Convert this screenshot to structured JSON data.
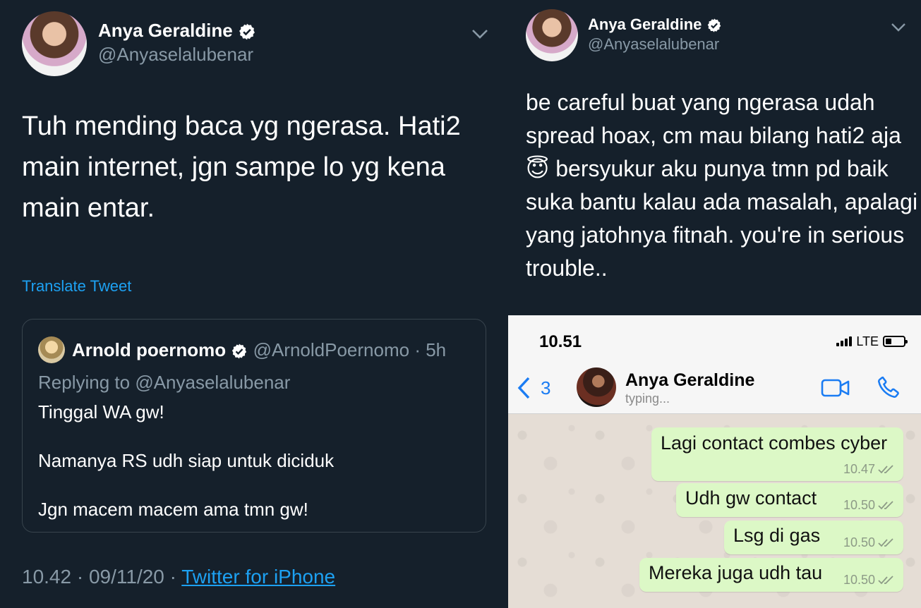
{
  "left_tweet": {
    "author_name": "Anya Geraldine",
    "author_handle": "@Anyaselalubenar",
    "text": "Tuh mending baca yg ngerasa. Hati2\nmain internet, jgn sampe lo yg kena\nmain entar.",
    "translate_label": "Translate Tweet",
    "quoted": {
      "author_name": "Arnold poernomo",
      "author_handle": "@ArnoldPoernomo",
      "age": "5h",
      "replying_label": "Replying to",
      "replying_to": "@Anyaselalubenar",
      "lines": [
        "Tinggal WA gw!",
        "Namanya RS udh siap untuk diciduk",
        "Jgn macem macem ama tmn gw!"
      ]
    },
    "timestamp": "10.42 · 09/11/20 ·",
    "source": "Twitter for iPhone"
  },
  "right_tweet": {
    "author_name": "Anya Geraldine",
    "author_handle": "@Anyaselalubenar",
    "text_lines": [
      "be careful buat yang ngerasa udah",
      "spread hoax, cm mau bilang hati2 aja",
      "😇 bersyukur aku punya tmn pd baik",
      "suka bantu kalau ada masalah, apalagi",
      "yang jatohnya fitnah. you're in serious",
      "trouble.."
    ]
  },
  "whatsapp": {
    "status_time": "10.51",
    "network": "LTE",
    "back_count": "3",
    "contact_name": "Anya Geraldine",
    "contact_status": "typing...",
    "messages": [
      {
        "text": "Lagi contact combes cyber",
        "time": "10.47"
      },
      {
        "text": "Udh gw contact",
        "time": "10.50"
      },
      {
        "text": "Lsg di gas",
        "time": "10.50"
      },
      {
        "text": "Mereka juga udh tau",
        "time": "10.50"
      }
    ]
  },
  "colors": {
    "twitter_bg": "#15202b",
    "twitter_link": "#1da1f2",
    "twitter_secondary": "#8899a6",
    "wa_bubble": "#dcf8c6",
    "ios_blue": "#1a7cf3"
  },
  "icons": {
    "verified": "verified-badge-icon",
    "menu": "chevron-down-icon",
    "back": "chevron-left-icon",
    "video": "video-call-icon",
    "phone": "phone-call-icon",
    "read_receipt": "double-check-icon"
  }
}
